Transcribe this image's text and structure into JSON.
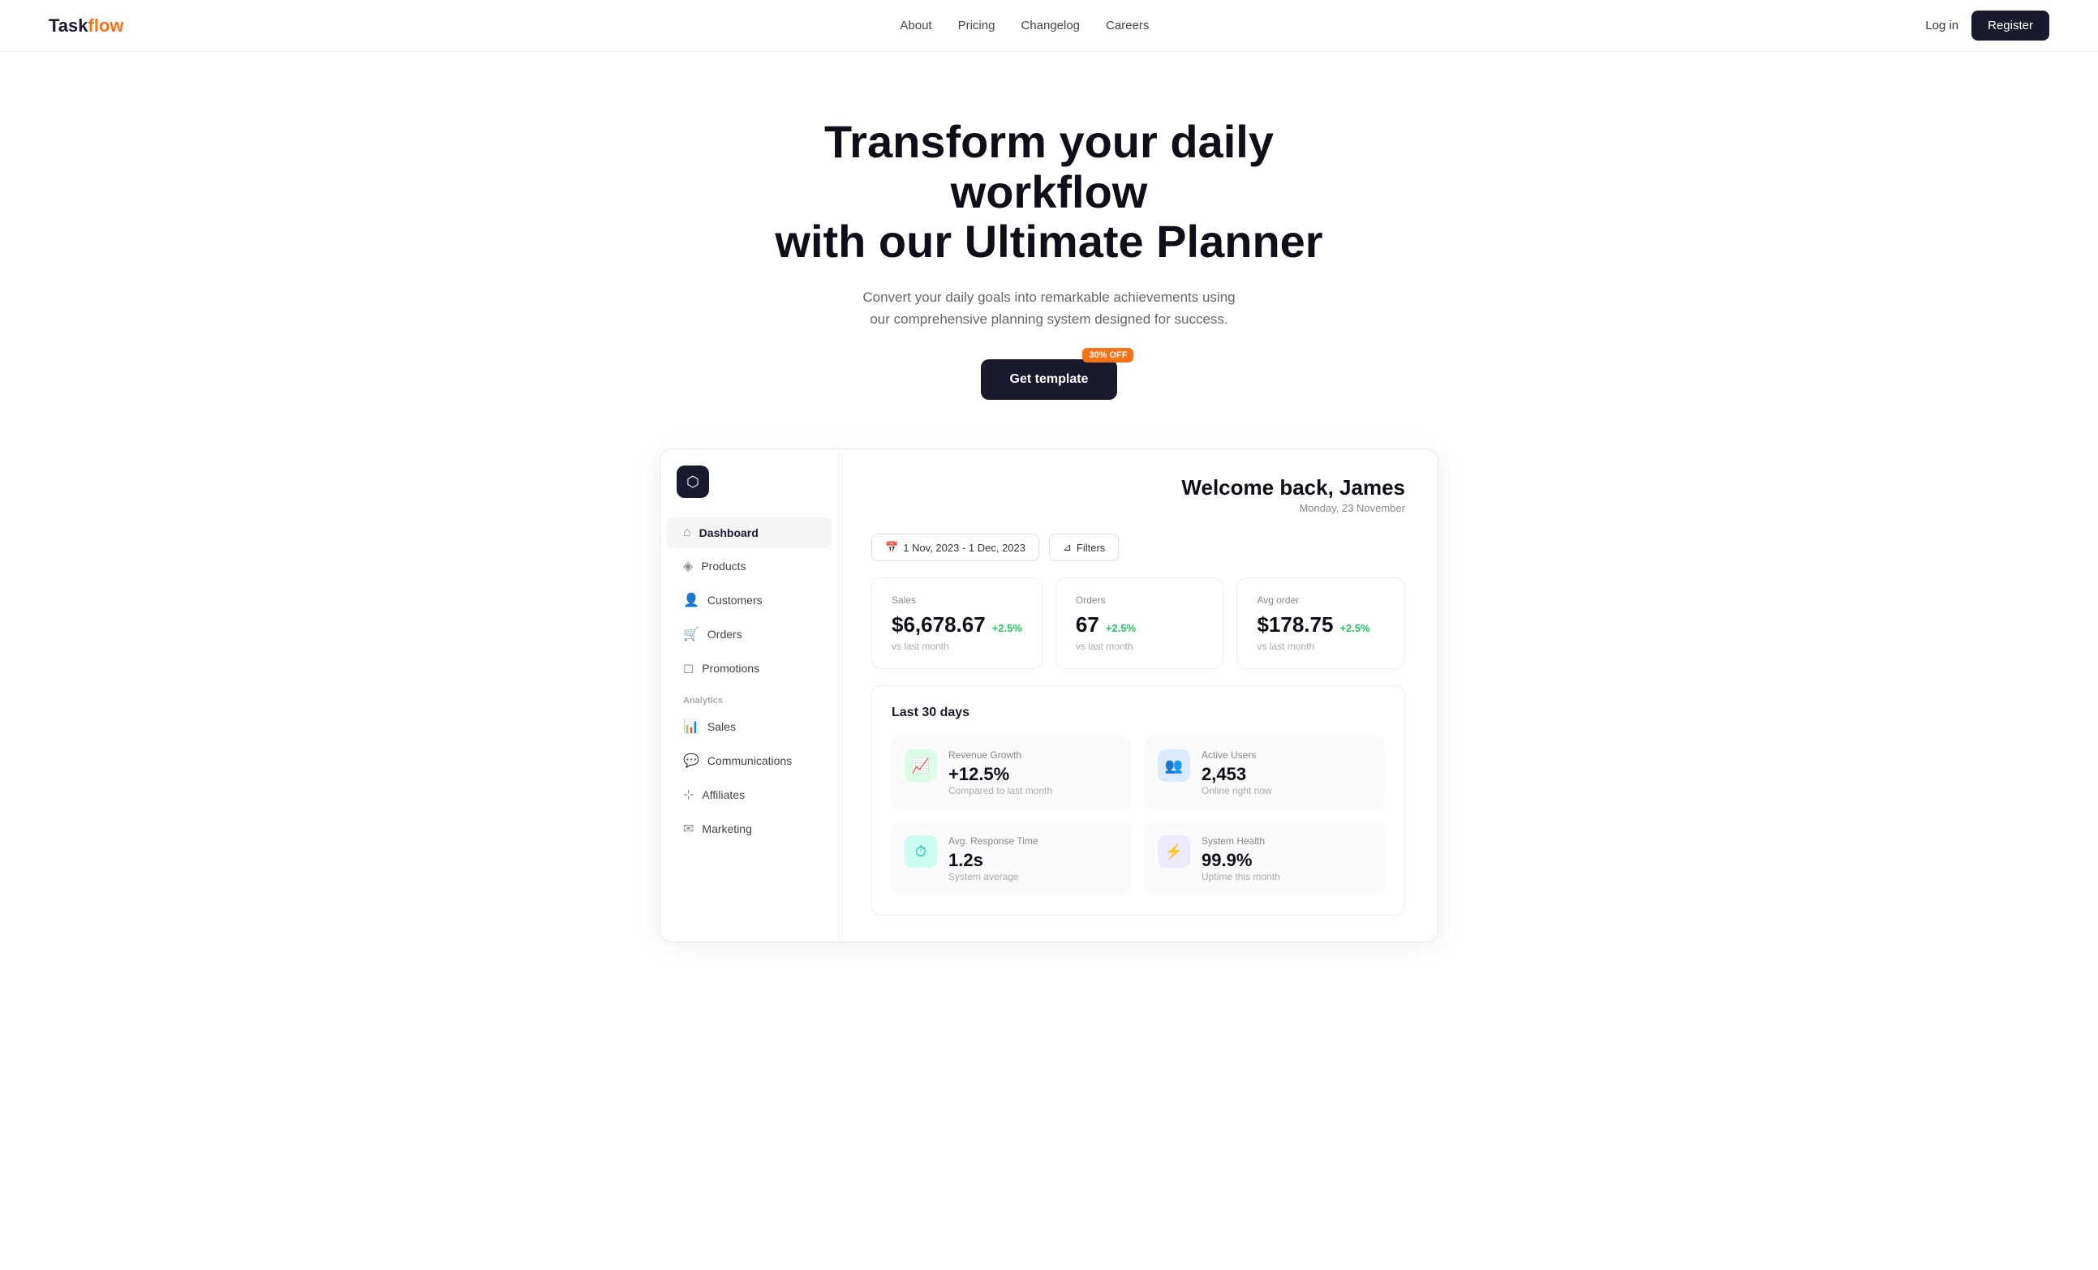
{
  "brand": {
    "name_part1": "Task",
    "name_part2": "flow"
  },
  "nav": {
    "links": [
      {
        "label": "About",
        "href": "#"
      },
      {
        "label": "Pricing",
        "href": "#"
      },
      {
        "label": "Changelog",
        "href": "#"
      },
      {
        "label": "Careers",
        "href": "#"
      }
    ],
    "login_label": "Log in",
    "register_label": "Register"
  },
  "hero": {
    "headline_line1": "Transform your daily workflow",
    "headline_line2": "with our Ultimate Planner",
    "subtext": "Convert your daily goals into remarkable achievements using our comprehensive planning system designed for success.",
    "badge": "30% OFF",
    "cta_label": "Get template"
  },
  "sidebar": {
    "logo_icon": "⬡",
    "nav_items": [
      {
        "label": "Dashboard",
        "icon": "⌂",
        "active": true
      },
      {
        "label": "Products",
        "icon": "◈"
      },
      {
        "label": "Customers",
        "icon": "👤"
      },
      {
        "label": "Orders",
        "icon": "🛒"
      },
      {
        "label": "Promotions",
        "icon": "◻"
      }
    ],
    "section_label": "Analytics",
    "analytics_items": [
      {
        "label": "Sales",
        "icon": "📊"
      },
      {
        "label": "Communications",
        "icon": "💬"
      },
      {
        "label": "Affiliates",
        "icon": "⊹"
      },
      {
        "label": "Marketing",
        "icon": "✉"
      }
    ]
  },
  "dashboard": {
    "welcome_title": "Welcome back, James",
    "welcome_date": "Monday, 23 November",
    "date_range": "1 Nov, 2023 - 1 Dec, 2023",
    "filters_label": "Filters",
    "stats": [
      {
        "label": "Sales",
        "value": "$6,678.67",
        "change": "+2.5%",
        "vs": "vs last month"
      },
      {
        "label": "Orders",
        "value": "67",
        "change": "+2.5%",
        "vs": "vs last month"
      },
      {
        "label": "Avg order",
        "value": "$178.75",
        "change": "+2.5%",
        "vs": "vs last month"
      }
    ],
    "analytics_title": "Last 30 days",
    "analytics_cards": [
      {
        "label": "Revenue Growth",
        "value": "+12.5%",
        "sub": "Compared to last month",
        "icon": "📈",
        "icon_class": "icon-green"
      },
      {
        "label": "Active Users",
        "value": "2,453",
        "sub": "Online right now",
        "icon": "👥",
        "icon_class": "icon-blue"
      },
      {
        "label": "Avg. Response Time",
        "value": "1.2s",
        "sub": "System average",
        "icon": "⏱",
        "icon_class": "icon-teal"
      },
      {
        "label": "System Health",
        "value": "99.9%",
        "sub": "Uptime this month",
        "icon": "⚡",
        "icon_class": "icon-purple"
      }
    ]
  }
}
